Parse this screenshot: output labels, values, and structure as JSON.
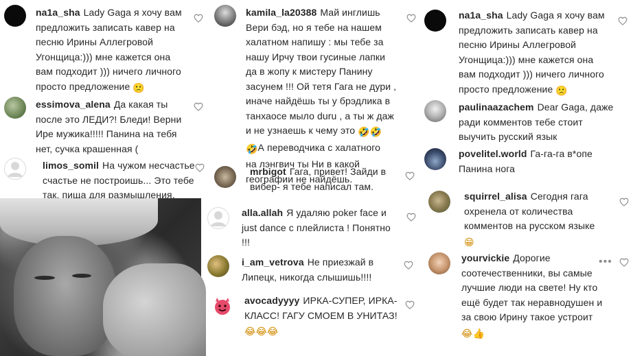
{
  "columns": [
    {
      "comments": [
        {
          "username": "na1a_sha",
          "lines": [
            "Lady Gaga я хочу вам",
            "предложить записать кавер на",
            "песню Ирины Аллегровой",
            "Угонщица:))) мне кажется она",
            "вам подходит ))) ничего личного",
            "просто предложение"
          ],
          "end_emoji": "🙁"
        },
        {
          "username": "essimova_alena",
          "lines": [
            "Да какая ты",
            "после это ЛЕДИ?! Бледи! Верни",
            "Ире мужика!!!!! Панина на тебя",
            "нет, сучка крашенная ("
          ]
        },
        {
          "username": "limos_somil",
          "lines": [
            "На чужом несчастье",
            "счастье не построишь... Это тебе",
            "так, пища для размышления."
          ]
        }
      ]
    },
    {
      "comments": [
        {
          "username": "kamila_la20388",
          "lines": [
            "Май инглишь",
            "Вери бэд, но я тебе на нашем",
            "халатном напишу : мы тебе за",
            "нашу Ирчу твои гусиные лапки",
            "да в жопу к мистеру Панину",
            "засунем !!! Ой тетя Гага не дури ,",
            "иначе найдёшь ты у брэдлика в",
            "танхаосе мыло duru , а ты ж даж",
            "и не узнаешь к чему это"
          ],
          "mid_emoji": "🤣🤣",
          "tail_emoji": "🤣",
          "tail_lines": [
            "А переводчика с халатного",
            "на лэнгвич ты Ни в какой",
            "географии не найдёшь."
          ]
        },
        {
          "username": "mrbigot",
          "lines": [
            "Гага, привет! Зайди в",
            "вибер- я тебе написал там."
          ]
        },
        {
          "username": "alla.allah",
          "lines": [
            "Я удаляю poker face и",
            "just dance с плейлиста ! Понятно",
            "!!!"
          ]
        },
        {
          "username": "i_am_vetrova",
          "lines": [
            "Не приезжай в",
            "Липецк, никогда слышишь!!!!"
          ]
        },
        {
          "username": "avocadyyyy",
          "lines": [
            "ИРКА-СУПЕР, ИРКА-",
            "КЛАСС! ГАГУ СМОЕМ В УНИТАЗ!"
          ],
          "end_emoji": "😂😂😂"
        }
      ]
    },
    {
      "comments": [
        {
          "username": "na1a_sha",
          "lines": [
            "Lady Gaga я хочу вам",
            "предложить записать кавер на",
            "песню Ирины Аллегровой",
            "Угонщица:))) мне кажется она",
            "вам подходит ))) ничего личного",
            "просто предложение"
          ],
          "end_emoji": "🙁"
        },
        {
          "username": "paulinaazachem",
          "lines": [
            "Dear Gaga, даже",
            "ради комментов тебе стоит",
            "выучить русский язык"
          ]
        },
        {
          "username": "povelitel.world",
          "lines": [
            "Га-га-га в*опе",
            "Панина нога"
          ]
        },
        {
          "username": "squirrel_alisa",
          "lines": [
            "Сегодня гага",
            "охренела от количества",
            "комментов на русском языке"
          ],
          "end_emoji": "😁"
        },
        {
          "username": "yourvickie",
          "lines": [
            "Дорогие",
            "соотечественники, вы самые",
            "лучшие люди на свете! Ну кто",
            "ещё будет так неравнодушен и",
            "за свою Ирину такое устроит"
          ],
          "end_emoji": "😂👍"
        }
      ]
    }
  ],
  "colors": {
    "text": "#262626",
    "heart": "#8e8e8e",
    "bg": "#ffffff"
  },
  "icons": {
    "like": "heart-outline-icon",
    "more": "more-dots-icon"
  }
}
